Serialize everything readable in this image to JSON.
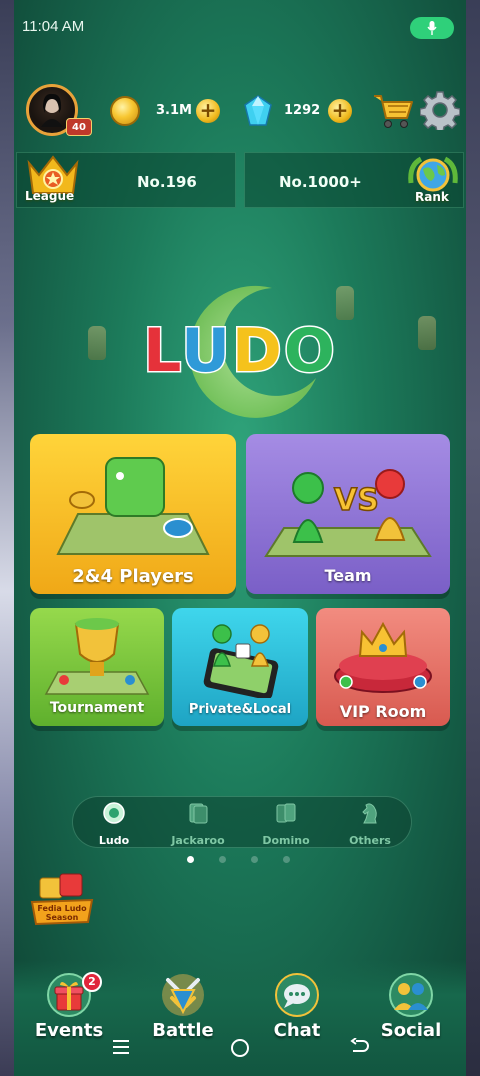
{
  "status_bar": {
    "time": "11:04 AM"
  },
  "profile": {
    "level": "40"
  },
  "currency": {
    "coins": "3.1M",
    "gems": "1292"
  },
  "ranks": {
    "league_label": "League",
    "league_position": "No.196",
    "rank_position": "No.1000+",
    "rank_label": "Rank"
  },
  "logo": {
    "letters": [
      "L",
      "U",
      "D",
      "O"
    ],
    "colors": [
      "#e5323a",
      "#2f9ad8",
      "#f5c21c",
      "#2db35d"
    ]
  },
  "modes": [
    {
      "label": "2&4 Players",
      "color": "#f3b81f"
    },
    {
      "label": "Team",
      "color": "#8a6fd2"
    },
    {
      "label": "Tournament",
      "color": "#79c23b"
    },
    {
      "label": "Private&Local",
      "color": "#2bbfd8"
    },
    {
      "label": "VIP Room",
      "color": "#e8726a"
    }
  ],
  "categories": [
    {
      "label": "Ludo",
      "active": true
    },
    {
      "label": "Jackaroo",
      "active": false
    },
    {
      "label": "Domino",
      "active": false
    },
    {
      "label": "Others",
      "active": false
    }
  ],
  "pager": {
    "pages": 4,
    "active": 1
  },
  "season_badge": {
    "line1": "Fedia Ludo",
    "line2": "Season"
  },
  "bottom_nav": [
    {
      "label": "Events",
      "badge": "2"
    },
    {
      "label": "Battle"
    },
    {
      "label": "Chat"
    },
    {
      "label": "Social"
    }
  ]
}
